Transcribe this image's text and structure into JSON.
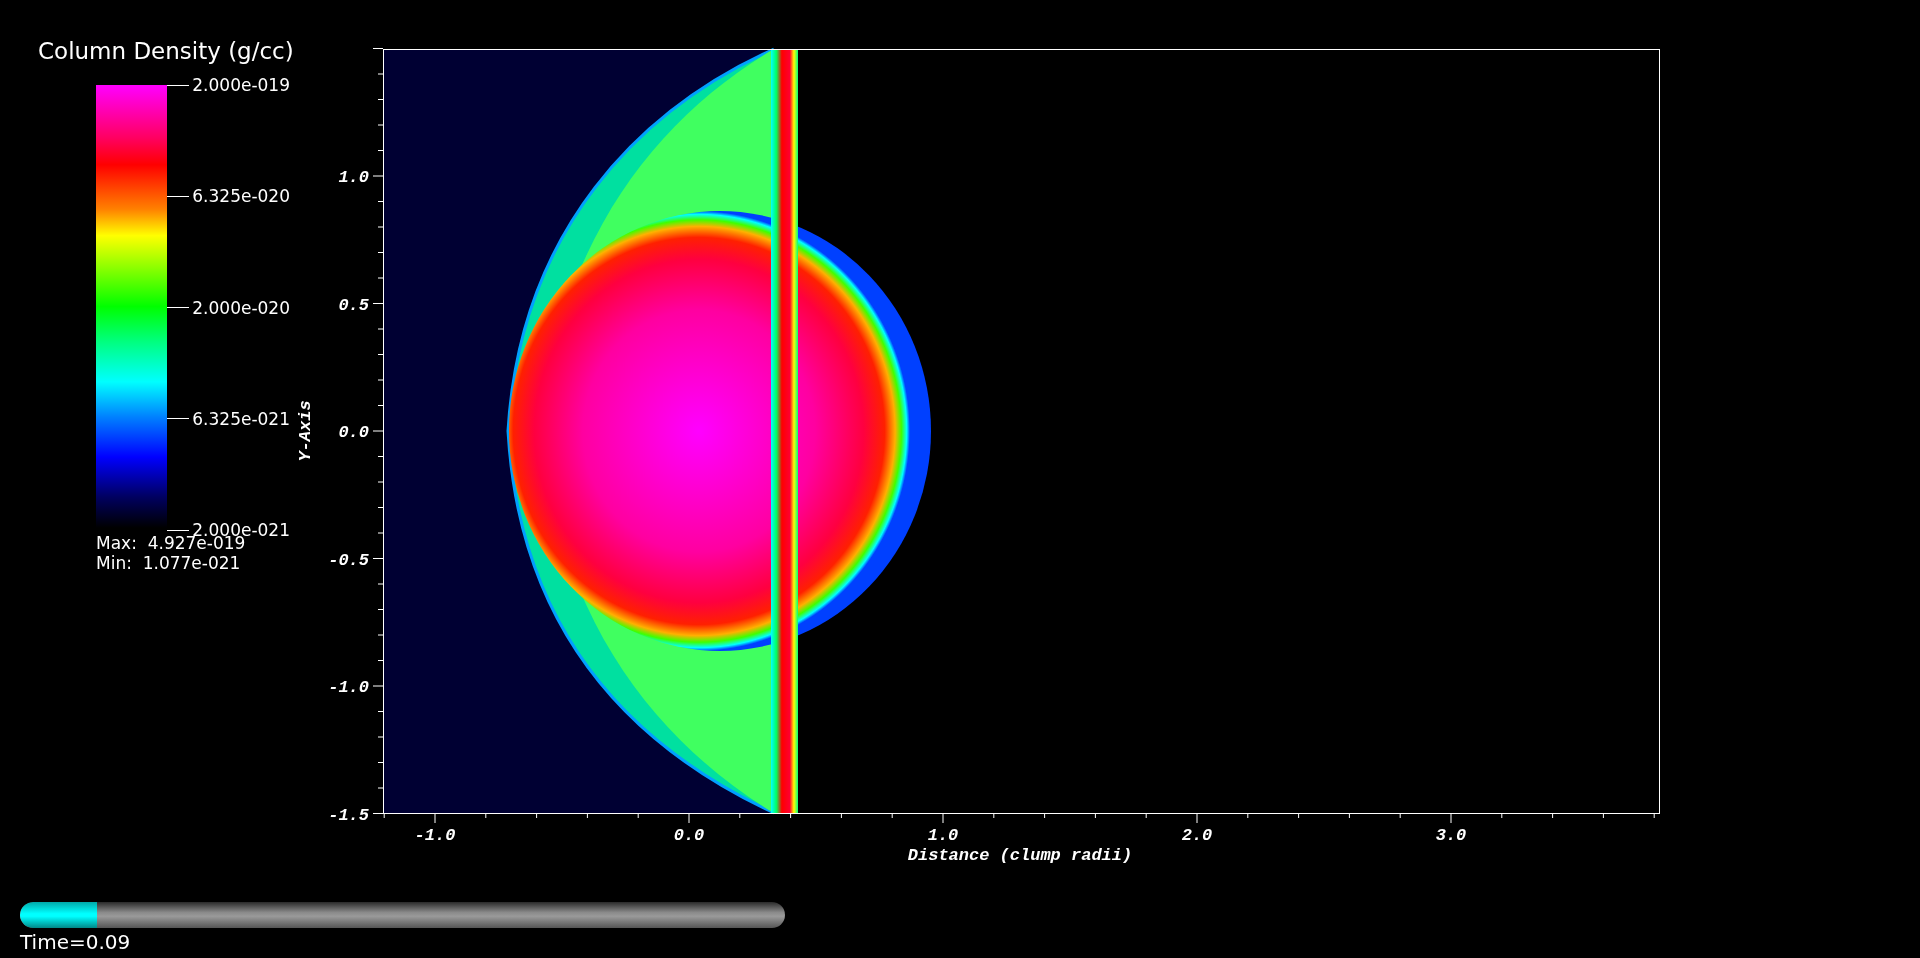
{
  "legend": {
    "title": "Column Density (g/cc)",
    "labels": [
      "2.000e-019",
      "6.325e-020",
      "2.000e-020",
      "6.325e-021",
      "2.000e-021"
    ],
    "max": "Max:  4.927e-019",
    "min": "Min:  1.077e-021"
  },
  "plot": {
    "y_axis": {
      "title": "Y-Axis",
      "ticks": [
        "1.0",
        "0.5",
        "0.0",
        "-0.5",
        "-1.0",
        "-1.5"
      ]
    },
    "x_axis": {
      "title": "Distance (clump radii)",
      "ticks": [
        "-1.0",
        "0.0",
        "1.0",
        "2.0",
        "3.0"
      ]
    }
  },
  "time_slider": {
    "level": 0.1,
    "label": "Time=0.09"
  }
}
